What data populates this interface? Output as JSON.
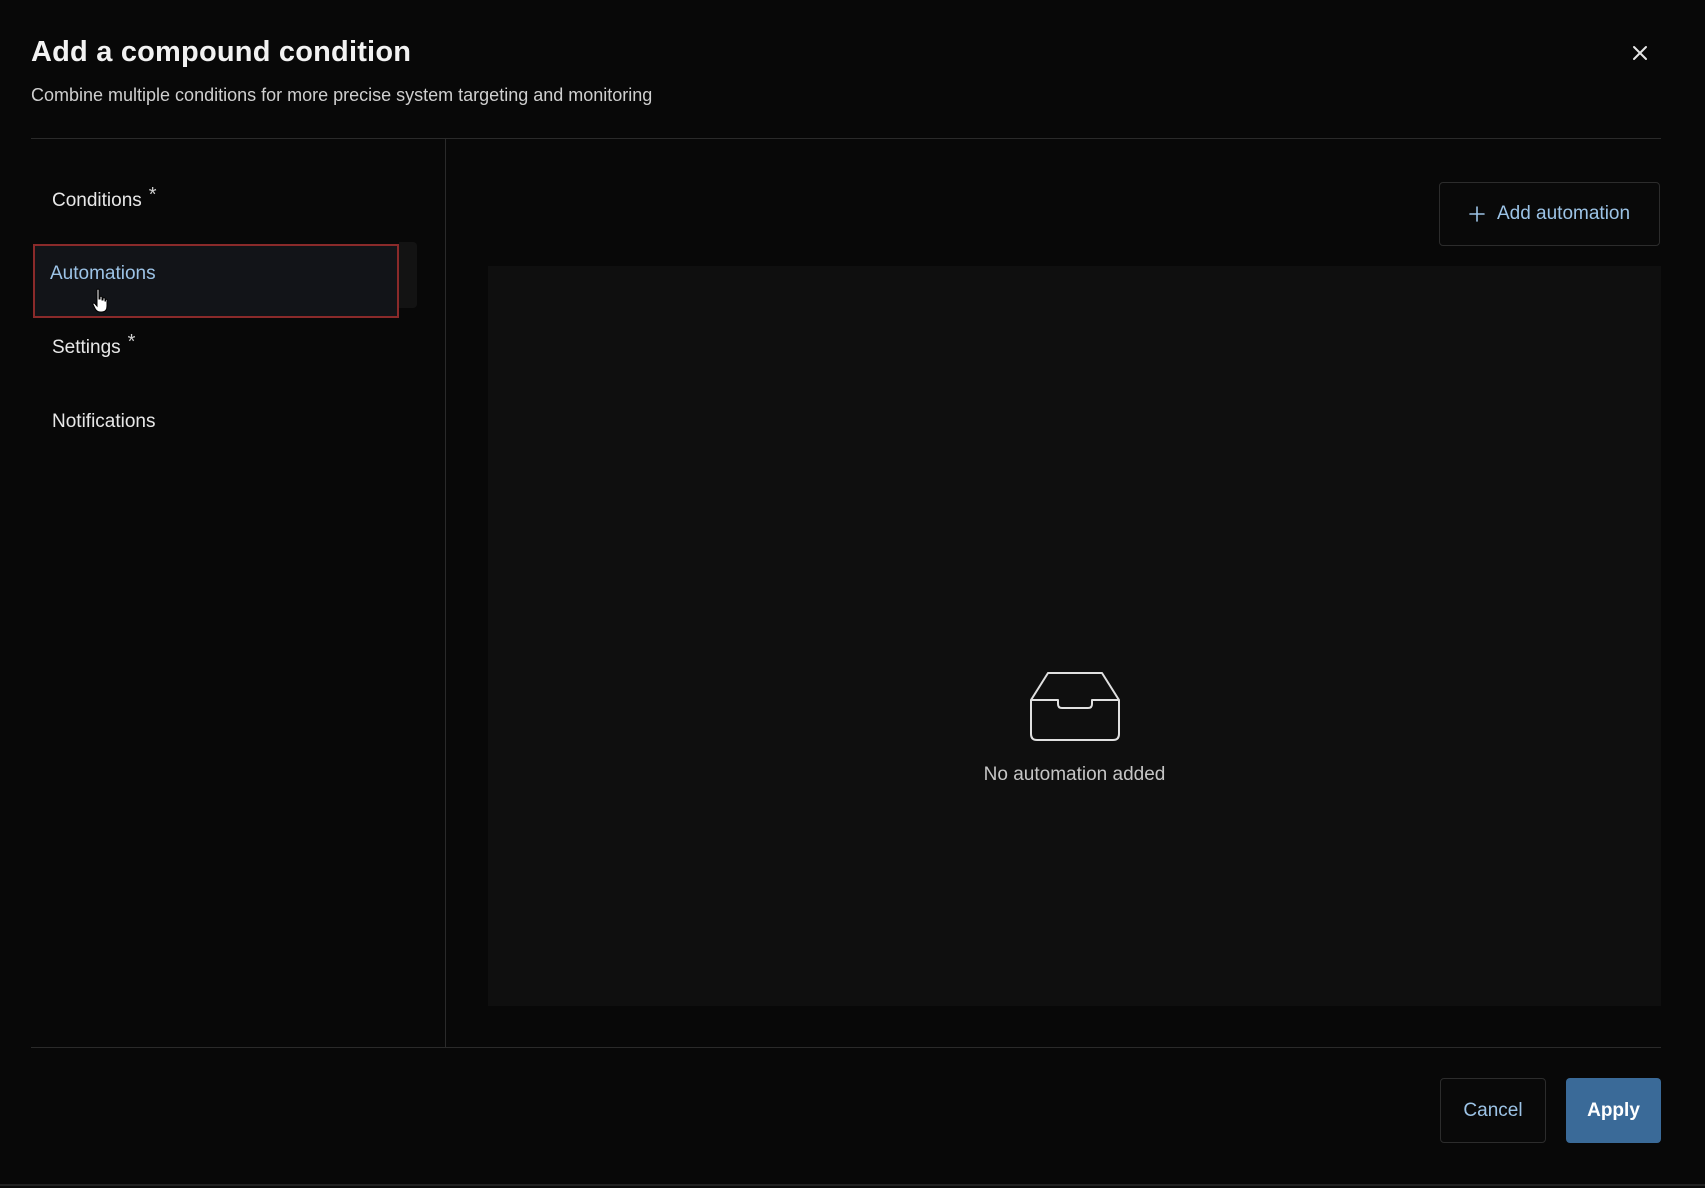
{
  "dialog": {
    "title": "Add a compound condition",
    "subtitle": "Combine multiple conditions for more precise system targeting and monitoring",
    "close_icon": "close-icon"
  },
  "sidebar": {
    "items": [
      {
        "label": "Conditions",
        "required": "*"
      },
      {
        "label": "Automations",
        "required": ""
      },
      {
        "label": "Settings",
        "required": "*"
      },
      {
        "label": "Notifications",
        "required": ""
      }
    ],
    "active_item": "Automations"
  },
  "content": {
    "add_button_icon": "plus-icon",
    "add_button_label": "Add automation",
    "empty_icon": "inbox-icon",
    "empty_text": "No automation added"
  },
  "footer": {
    "cancel_label": "Cancel",
    "apply_label": "Apply"
  },
  "colors": {
    "background": "#080808",
    "accent_text": "#9cc3e6",
    "primary_button": "#3a6a98",
    "active_outline": "#8a2a2a"
  }
}
